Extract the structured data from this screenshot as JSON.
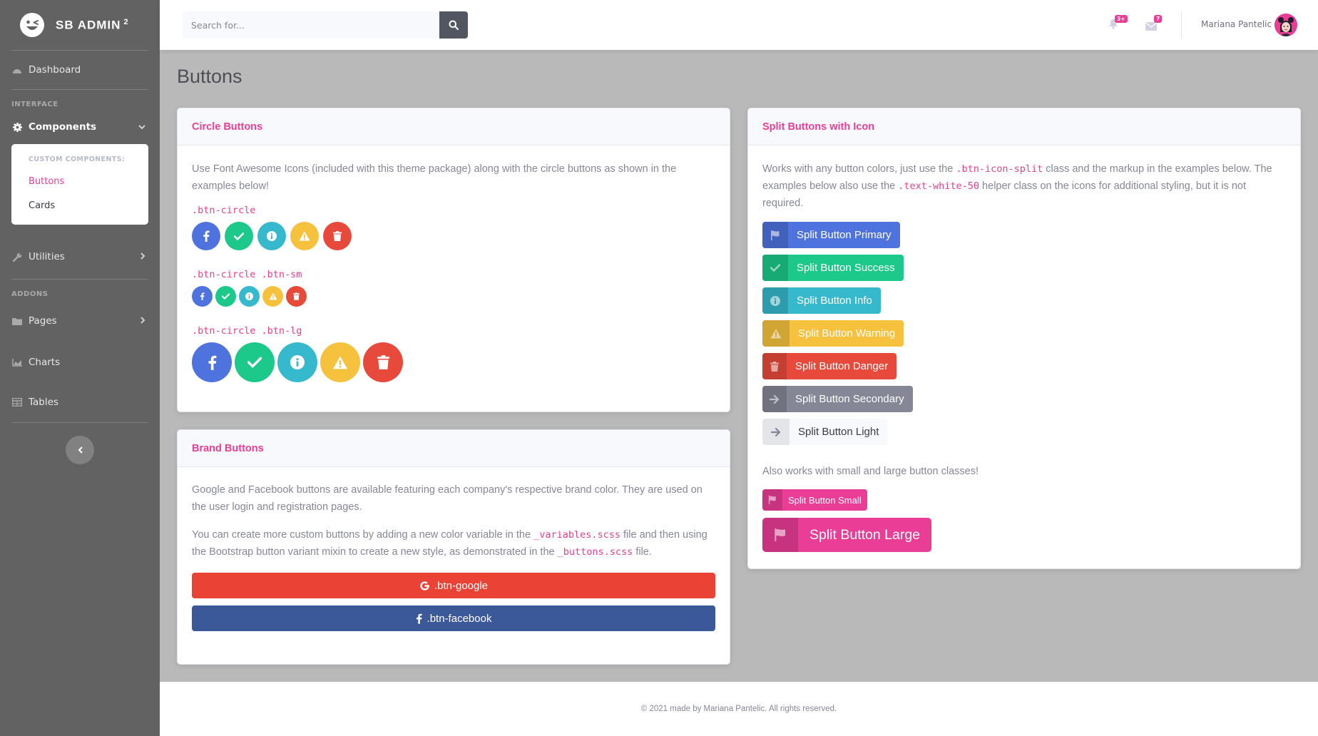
{
  "brand": {
    "name": "SB ADMIN",
    "sup": "2"
  },
  "sidebar": {
    "dashboard": "Dashboard",
    "heading_interface": "INTERFACE",
    "components": "Components",
    "collapse_header": "CUSTOM COMPONENTS:",
    "buttons": "Buttons",
    "cards": "Cards",
    "utilities": "Utilities",
    "heading_addons": "ADDONS",
    "pages": "Pages",
    "charts": "Charts",
    "tables": "Tables"
  },
  "topbar": {
    "search_placeholder": "Search for...",
    "alerts_badge": "3+",
    "messages_badge": "7",
    "user_name": "Mariana Pantelic"
  },
  "page": {
    "title": "Buttons"
  },
  "circle_card": {
    "title": "Circle Buttons",
    "description": "Use Font Awesome Icons (included with this theme package) along with the circle buttons as shown in the examples below!",
    "label_default": ".btn-circle",
    "label_sm": ".btn-circle .btn-sm",
    "label_lg": ".btn-circle .btn-lg"
  },
  "brand_card": {
    "title": "Brand Buttons",
    "p1": "Google and Facebook buttons are available featuring each company's respective brand color. They are used on the user login and registration pages.",
    "p2_a": "You can create more custom buttons by adding a new color variable in the ",
    "p2_code1": "_variables.scss",
    "p2_b": " file and then using the Bootstrap button variant mixin to create a new style, as demonstrated in the ",
    "p2_code2": "_buttons.scss",
    "p2_c": " file.",
    "google": ".btn-google",
    "facebook": ".btn-facebook"
  },
  "split_card": {
    "title": "Split Buttons with Icon",
    "desc_a": "Works with any button colors, just use the ",
    "desc_code1": ".btn-icon-split",
    "desc_b": " class and the markup in the examples below. The examples below also use the ",
    "desc_code2": ".text-white-50",
    "desc_c": " helper class on the icons for additional styling, but it is not required.",
    "primary": "Split Button Primary",
    "success": "Split Button Success",
    "info": "Split Button Info",
    "warning": "Split Button Warning",
    "danger": "Split Button Danger",
    "secondary": "Split Button Secondary",
    "light": "Split Button Light",
    "also": "Also works with small and large button classes!",
    "small": "Split Button Small",
    "large": "Split Button Large"
  },
  "footer": {
    "text": "© 2021 made by Mariana Pantelic. All rights reserved."
  },
  "colors": {
    "accent": "#ea3d96",
    "primary": "#4e73df",
    "success": "#1cc88a",
    "info": "#36b9cc",
    "warning": "#f6c23e",
    "danger": "#e74a3b",
    "secondary": "#858796",
    "google": "#ea4335",
    "facebook": "#3b5998"
  },
  "icons": [
    "laugh-wink-icon",
    "tachometer-icon",
    "cog-icon",
    "wrench-icon",
    "folder-icon",
    "chart-area-icon",
    "table-icon",
    "search-icon",
    "bell-icon",
    "envelope-icon",
    "facebook-icon",
    "check-icon",
    "info-icon",
    "warning-icon",
    "trash-icon",
    "flag-icon",
    "arrow-right-icon",
    "google-icon"
  ]
}
